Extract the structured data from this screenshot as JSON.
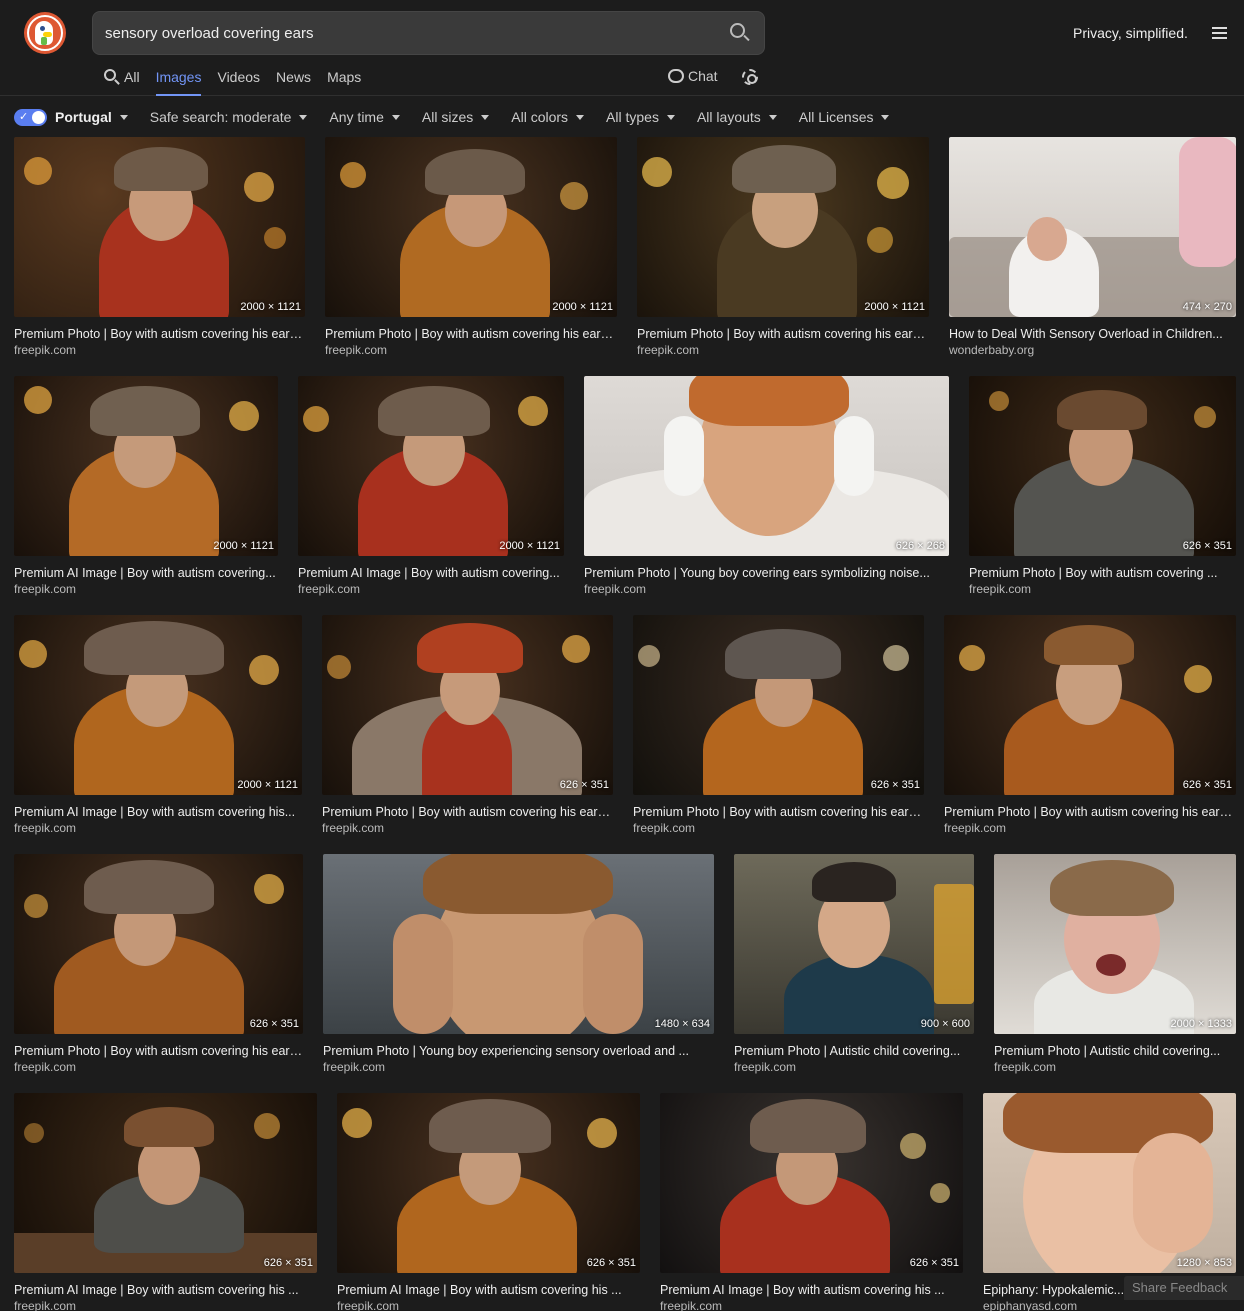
{
  "search": {
    "query": "sensory overload covering ears"
  },
  "header": {
    "tagline": "Privacy, simplified."
  },
  "nav": {
    "tabs": [
      {
        "label": "All"
      },
      {
        "label": "Images"
      },
      {
        "label": "Videos"
      },
      {
        "label": "News"
      },
      {
        "label": "Maps"
      }
    ],
    "chat_label": "Chat"
  },
  "filters": {
    "region": "Portugal",
    "safe_search": "Safe search: moderate",
    "time": "Any time",
    "sizes": "All sizes",
    "colors": "All colors",
    "types": "All types",
    "layouts": "All layouts",
    "licenses": "All Licenses"
  },
  "results": [
    [
      {
        "caption": "Premium Photo | Boy with autism covering his ears...",
        "source": "freepik.com",
        "dims": "2000 × 1121"
      },
      {
        "caption": "Premium Photo | Boy with autism covering his ears...",
        "source": "freepik.com",
        "dims": "2000 × 1121"
      },
      {
        "caption": "Premium Photo | Boy with autism covering his ears...",
        "source": "freepik.com",
        "dims": "2000 × 1121"
      },
      {
        "caption": "How to Deal With Sensory Overload in Children...",
        "source": "wonderbaby.org",
        "dims": "474 × 270"
      }
    ],
    [
      {
        "caption": "Premium AI Image | Boy with autism covering...",
        "source": "freepik.com",
        "dims": "2000 × 1121"
      },
      {
        "caption": "Premium AI Image | Boy with autism covering...",
        "source": "freepik.com",
        "dims": "2000 × 1121"
      },
      {
        "caption": "Premium Photo | Young boy covering ears symbolizing noise...",
        "source": "freepik.com",
        "dims": "626 × 268"
      },
      {
        "caption": "Premium Photo | Boy with autism covering ...",
        "source": "freepik.com",
        "dims": "626 × 351"
      }
    ],
    [
      {
        "caption": "Premium AI Image | Boy with autism covering his...",
        "source": "freepik.com",
        "dims": "2000 × 1121"
      },
      {
        "caption": "Premium Photo | Boy with autism covering his ears...",
        "source": "freepik.com",
        "dims": "626 × 351"
      },
      {
        "caption": "Premium Photo | Boy with autism covering his ears...",
        "source": "freepik.com",
        "dims": "626 × 351"
      },
      {
        "caption": "Premium Photo | Boy with autism covering his ears...",
        "source": "freepik.com",
        "dims": "626 × 351"
      }
    ],
    [
      {
        "caption": "Premium Photo | Boy with autism covering his ears...",
        "source": "freepik.com",
        "dims": "626 × 351"
      },
      {
        "caption": "Premium Photo | Young boy experiencing sensory overload and ...",
        "source": "freepik.com",
        "dims": "1480 × 634"
      },
      {
        "caption": "Premium Photo | Autistic child covering...",
        "source": "freepik.com",
        "dims": "900 × 600"
      },
      {
        "caption": "Premium Photo | Autistic child covering...",
        "source": "freepik.com",
        "dims": "2000 × 1333"
      }
    ],
    [
      {
        "caption": "Premium AI Image | Boy with autism covering his ...",
        "source": "freepik.com",
        "dims": "626 × 351"
      },
      {
        "caption": "Premium AI Image | Boy with autism covering his ...",
        "source": "freepik.com",
        "dims": "626 × 351"
      },
      {
        "caption": "Premium AI Image | Boy with autism covering his ...",
        "source": "freepik.com",
        "dims": "626 × 351"
      },
      {
        "caption": "Epiphany: Hypokalemic...",
        "source": "epiphanyasd.com",
        "dims": "1280 × 853"
      }
    ]
  ],
  "feedback_label": "Share Feedback"
}
